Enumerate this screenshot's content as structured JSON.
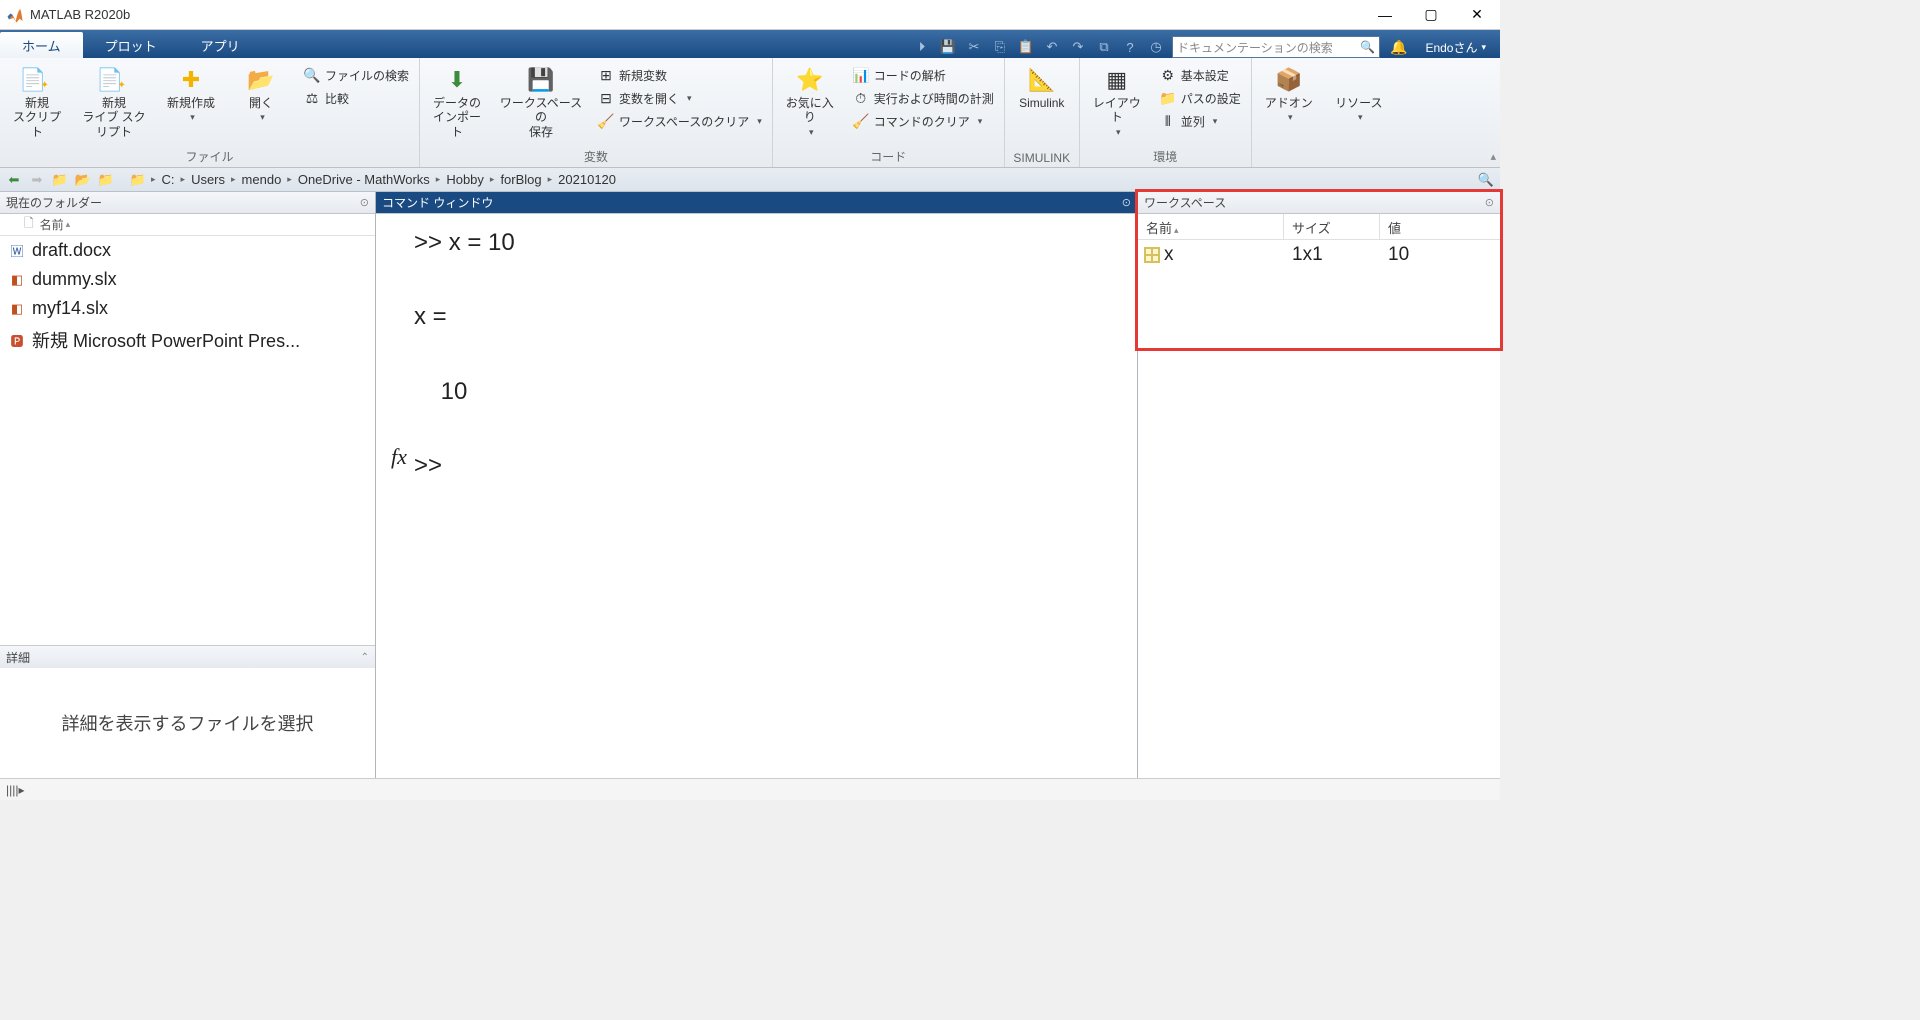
{
  "window": {
    "title": "MATLAB R2020b"
  },
  "tabs": {
    "home": "ホーム",
    "plot": "プロット",
    "app": "アプリ"
  },
  "search_placeholder": "ドキュメンテーションの検索",
  "user": "Endoさん",
  "ribbon": {
    "file": {
      "new_script": "新規\nスクリプト",
      "new_live": "新規\nライブ スクリプト",
      "new": "新規作成",
      "open": "開く",
      "find_files": "ファイルの検索",
      "compare": "比較",
      "label": "ファイル"
    },
    "variable": {
      "import": "データの\nインポート",
      "save_ws": "ワークスペースの\n保存",
      "new_var": "新規変数",
      "open_var": "変数を開く",
      "clear_ws": "ワークスペースのクリア",
      "label": "変数"
    },
    "code": {
      "favorites": "お気に入り",
      "analyze": "コードの解析",
      "runtime": "実行および時間の計測",
      "clear_cmd": "コマンドのクリア",
      "label": "コード"
    },
    "simulink": {
      "btn": "Simulink",
      "label": "SIMULINK"
    },
    "env": {
      "layout": "レイアウト",
      "prefs": "基本設定",
      "setpath": "パスの設定",
      "parallel": "並列",
      "label": "環境"
    },
    "res": {
      "addons": "アドオン",
      "resources": "リソース"
    }
  },
  "breadcrumbs": [
    "C:",
    "Users",
    "mendo",
    "OneDrive - MathWorks",
    "Hobby",
    "forBlog",
    "20210120"
  ],
  "current_folder": {
    "title": "現在のフォルダー",
    "col": "名前",
    "files": [
      {
        "name": "draft.docx",
        "icon": "word"
      },
      {
        "name": "dummy.slx",
        "icon": "slx"
      },
      {
        "name": "myf14.slx",
        "icon": "slx"
      },
      {
        "name": "新規 Microsoft PowerPoint Pres...",
        "icon": "ppt"
      }
    ],
    "details": "詳細",
    "details_hint": "詳細を表示するファイルを選択"
  },
  "command_window": {
    "title": "コマンド ウィンドウ",
    "line1": ">> x = 10",
    "line2": "x =",
    "line3": "    10",
    "prompt": ">> "
  },
  "workspace": {
    "title": "ワークスペース",
    "cols": {
      "name": "名前",
      "size": "サイズ",
      "value": "値"
    },
    "vars": [
      {
        "name": "x",
        "size": "1x1",
        "value": "10"
      }
    ]
  }
}
